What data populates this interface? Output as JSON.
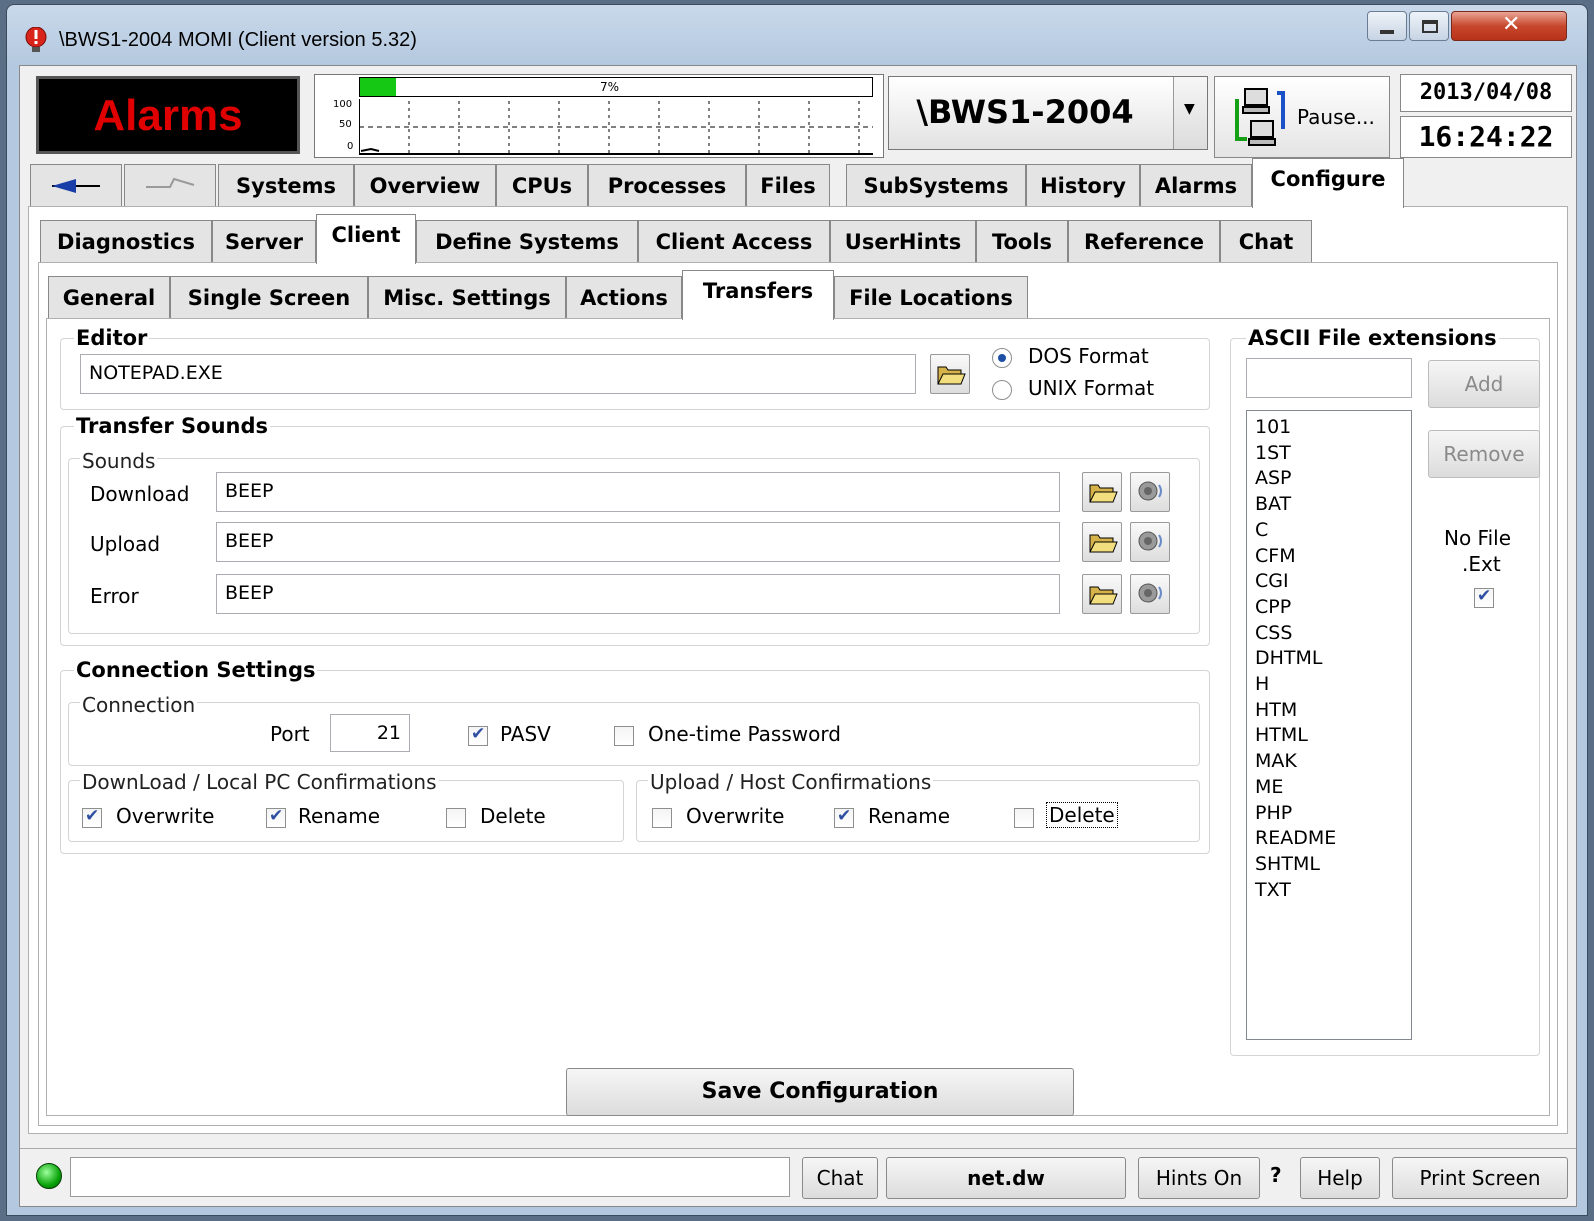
{
  "window": {
    "title": "\\BWS1-2004 MOMI (Client version 5.32)"
  },
  "header": {
    "alarms_label": "Alarms",
    "cpu_percent_label": "7%",
    "cpu_percent": 7,
    "graph_ticks": [
      "100",
      "50",
      "0"
    ],
    "system": "\\BWS1-2004",
    "pause_label": "Pause...",
    "date": "2013/04/08",
    "time": "16:24:22"
  },
  "main_tabs": [
    "Systems",
    "Overview",
    "CPUs",
    "Processes",
    "Files",
    "SubSystems",
    "History",
    "Alarms",
    "Configure"
  ],
  "config_tabs": [
    "Diagnostics",
    "Server",
    "Client",
    "Define Systems",
    "Client Access",
    "UserHints",
    "Tools",
    "Reference",
    "Chat"
  ],
  "client_tabs": [
    "General",
    "Single Screen",
    "Misc. Settings",
    "Actions",
    "Transfers",
    "File Locations"
  ],
  "editor": {
    "title": "Editor",
    "value": "NOTEPAD.EXE",
    "format_dos": "DOS Format",
    "format_unix": "UNIX Format",
    "selected_format": "DOS Format"
  },
  "sounds": {
    "title": "Transfer Sounds",
    "group": "Sounds",
    "rows": [
      {
        "label": "Download",
        "value": "BEEP"
      },
      {
        "label": "Upload",
        "value": "BEEP"
      },
      {
        "label": "Error",
        "value": "BEEP"
      }
    ]
  },
  "connection": {
    "title": "Connection Settings",
    "group": "Connection",
    "port_label": "Port",
    "port_value": "21",
    "pasv_label": "PASV",
    "pasv_checked": true,
    "otp_label": "One-time Password",
    "otp_checked": false,
    "download_group": "DownLoad / Local PC Confirmations",
    "download": {
      "overwrite": "Overwrite",
      "rename": "Rename",
      "delete": "Delete"
    },
    "upload_group": "Upload / Host Confirmations",
    "upload": {
      "overwrite": "Overwrite",
      "rename": "Rename",
      "delete": "Delete"
    }
  },
  "ascii": {
    "title": "ASCII File extensions",
    "input_value": "",
    "add_label": "Add",
    "remove_label": "Remove",
    "no_file_ext_label_1": "No File",
    "no_file_ext_label_2": ".Ext",
    "no_file_ext_checked": true,
    "extensions": [
      "101",
      "1ST",
      "ASP",
      "BAT",
      "C",
      "CFM",
      "CGI",
      "CPP",
      "CSS",
      "DHTML",
      "H",
      "HTM",
      "HTML",
      "MAK",
      "ME",
      "PHP",
      "README",
      "SHTML",
      "TXT"
    ]
  },
  "save_label": "Save Configuration",
  "status": {
    "message": "",
    "chat_label": "Chat",
    "host": "net.dw",
    "hints_label": "Hints On",
    "question": "?",
    "help_label": "Help",
    "print_label": "Print Screen"
  }
}
